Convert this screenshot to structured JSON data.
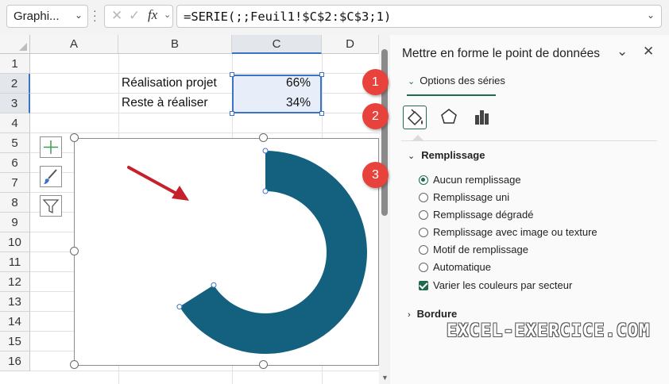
{
  "formula_bar": {
    "name_box": "Graphi...",
    "fx": "fx",
    "formula": "=SERIE(;;Feuil1!$C$2:$C$3;1)"
  },
  "sheet": {
    "columns": [
      "A",
      "B",
      "C",
      "D"
    ],
    "rows": [
      "1",
      "2",
      "3",
      "4",
      "5",
      "6",
      "7",
      "8",
      "9",
      "10",
      "11",
      "12",
      "13",
      "14",
      "15",
      "16"
    ],
    "cells": {
      "B2": "Réalisation projet",
      "C2": "66%",
      "B3": "Reste à réaliser",
      "C3": "34%"
    }
  },
  "chart": {
    "type": "doughnut",
    "visible_series_percent": 66,
    "ring_color": "#14607f"
  },
  "pane": {
    "title": "Mettre en forme le point de données",
    "options_label": "Options des séries",
    "tabs": [
      "fill-line",
      "effects",
      "series-options"
    ],
    "fill_section": "Remplissage",
    "fill_options": [
      {
        "label": "Aucun remplissage",
        "selected": true
      },
      {
        "label": "Remplissage uni",
        "selected": false
      },
      {
        "label": "Remplissage dégradé",
        "selected": false
      },
      {
        "label": "Remplissage avec image ou texture",
        "selected": false
      },
      {
        "label": "Motif de remplissage",
        "selected": false
      },
      {
        "label": "Automatique",
        "selected": false
      }
    ],
    "vary_colors_label": "Varier les couleurs par secteur",
    "vary_colors_checked": true,
    "border_section": "Bordure"
  },
  "watermark": "EXCEL-EXERCICE.COM",
  "annotations": [
    "1",
    "2",
    "3"
  ],
  "colors": {
    "accent": "#1e6b4e",
    "badge": "#e8423c",
    "arrow": "#c4212b"
  }
}
